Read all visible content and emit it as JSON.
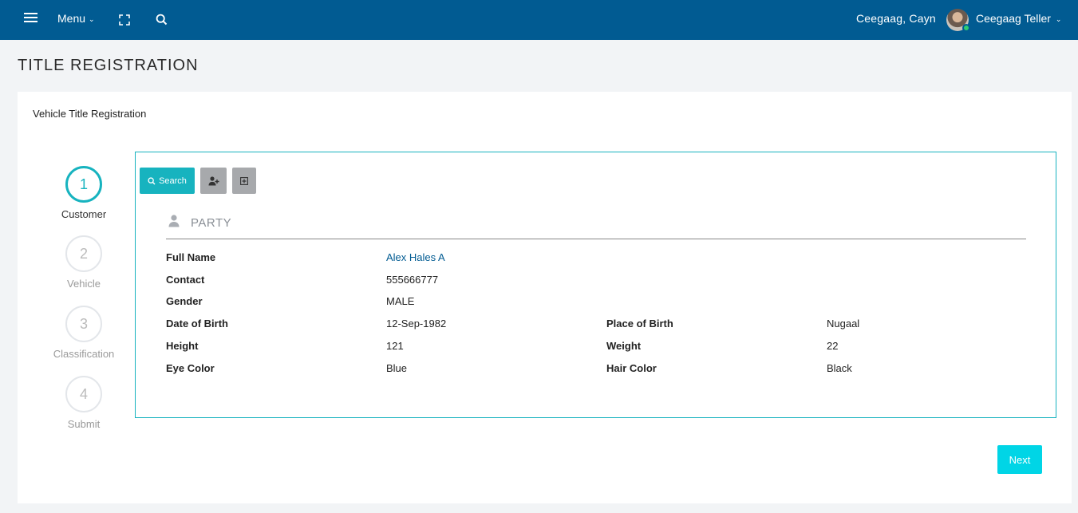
{
  "header": {
    "menu_label": "Menu",
    "user_name": "Ceegaag, Cayn",
    "role_label": "Ceegaag Teller",
    "bar_color": "#015b92"
  },
  "page": {
    "title": "TITLE REGISTRATION",
    "card_title": "Vehicle Title Registration"
  },
  "stepper": {
    "accent_color": "#17b3bf",
    "active_step": 1,
    "steps": [
      {
        "number": "1",
        "label": "Customer"
      },
      {
        "number": "2",
        "label": "Vehicle"
      },
      {
        "number": "3",
        "label": "Classification"
      },
      {
        "number": "4",
        "label": "Submit"
      }
    ]
  },
  "toolbar": {
    "search_label": "Search",
    "add_user_icon": "user-plus-icon",
    "expand_icon": "plus-square-icon"
  },
  "party": {
    "section_title": "PARTY",
    "fields": {
      "full_name": {
        "label": "Full Name",
        "value": "Alex Hales A"
      },
      "contact": {
        "label": "Contact",
        "value": "555666777"
      },
      "gender": {
        "label": "Gender",
        "value": "MALE"
      },
      "date_of_birth": {
        "label": "Date of Birth",
        "value": "12-Sep-1982"
      },
      "place_of_birth": {
        "label": "Place of Birth",
        "value": "Nugaal"
      },
      "height": {
        "label": "Height",
        "value": "121"
      },
      "weight": {
        "label": "Weight",
        "value": "22"
      },
      "eye_color": {
        "label": "Eye Color",
        "value": "Blue"
      },
      "hair_color": {
        "label": "Hair Color",
        "value": "Black"
      }
    }
  },
  "footer": {
    "next_label": "Next"
  }
}
